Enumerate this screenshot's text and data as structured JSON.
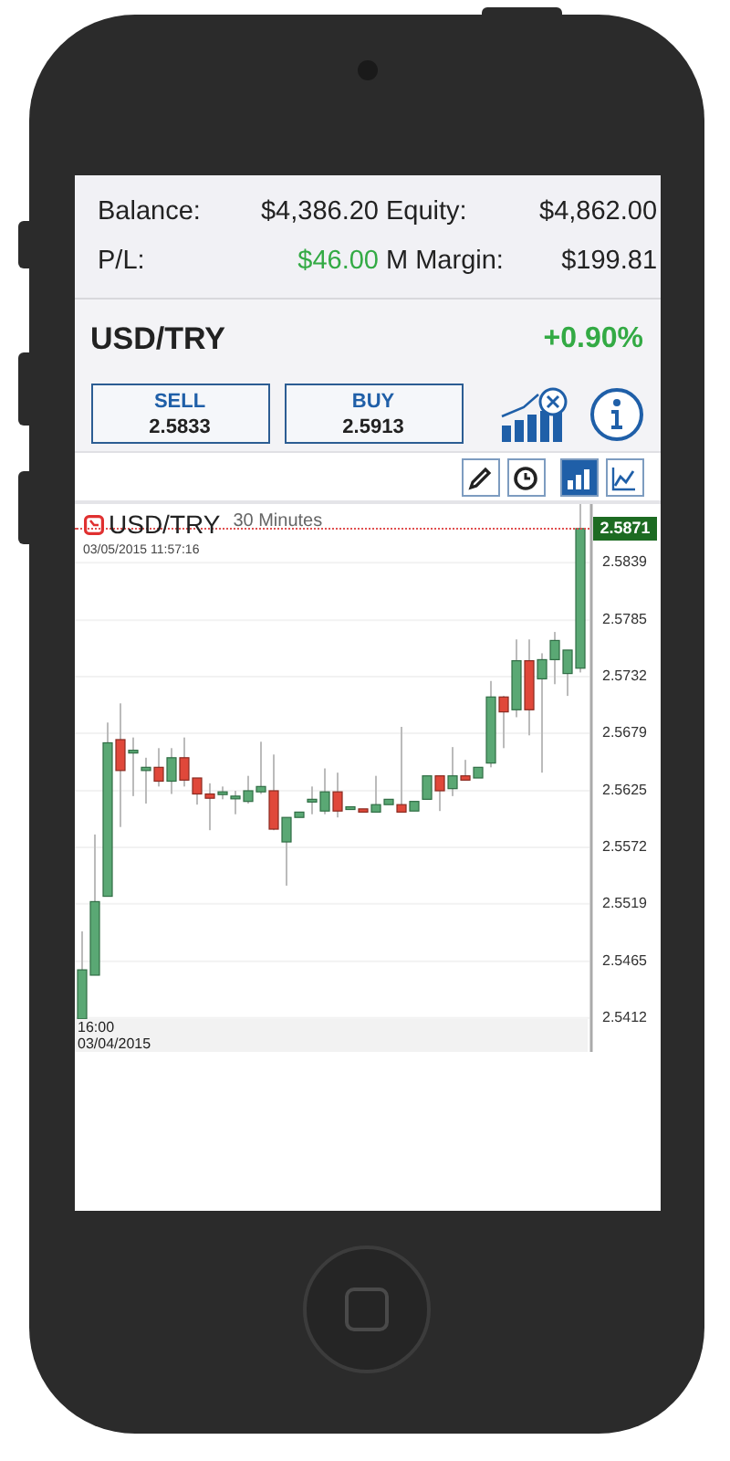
{
  "account": [
    {
      "label": "Balance:",
      "value": "$4,386.20",
      "positive": false
    },
    {
      "label": "Equity:",
      "value": "$4,862.00",
      "positive": false
    },
    {
      "label": "P/L:",
      "value": "$46.00",
      "positive": true
    },
    {
      "label": "M Margin:",
      "value": "$199.81",
      "positive": false
    }
  ],
  "instrument": {
    "symbol": "USD/TRY",
    "change": "+0.90%",
    "positive": true
  },
  "trade_buttons": [
    {
      "label": "SELL",
      "price": "2.5833"
    },
    {
      "label": "BUY",
      "price": "2.5913"
    }
  ],
  "toolbar": [
    {
      "kind": "pencil",
      "selected": false
    },
    {
      "kind": "clock",
      "selected": false
    },
    {
      "kind": "bars",
      "selected": true
    },
    {
      "kind": "line",
      "selected": false
    }
  ],
  "chart": {
    "symbol": "USD/TRY",
    "interval": "30 Minutes",
    "timestamp": "03/05/2015 11:57:16",
    "current_price": "2.5871",
    "time_label": "16:00",
    "date_label": "03/04/2015",
    "chart_data": {
      "type": "candlestick",
      "ylim": [
        2.538,
        2.5894
      ],
      "grid": true,
      "categories": [
        null,
        null,
        null,
        null,
        null,
        null,
        null,
        null,
        null,
        null,
        null,
        null,
        null,
        null,
        null,
        null,
        null,
        null,
        null,
        null,
        null,
        null,
        null,
        null,
        null,
        null,
        null,
        null,
        null,
        null,
        null,
        null,
        null,
        null,
        null,
        null,
        null,
        null,
        null,
        null
      ],
      "yticks": [
        {
          "value": 2.5839,
          "label": "2.5839"
        },
        {
          "value": 2.5785,
          "label": "2.5785"
        },
        {
          "value": 2.5732,
          "label": "2.5732"
        },
        {
          "value": 2.5679,
          "label": "2.5679"
        },
        {
          "value": 2.5625,
          "label": "2.5625"
        },
        {
          "value": 2.5572,
          "label": "2.5572"
        },
        {
          "value": 2.5519,
          "label": "2.5519"
        },
        {
          "value": 2.5465,
          "label": "2.5465"
        },
        {
          "value": 2.5412,
          "label": "2.5412"
        }
      ],
      "ohlc": [
        [
          2.5411,
          2.5493,
          2.5411,
          2.5457
        ],
        [
          2.5452,
          2.5584,
          2.5452,
          2.5521
        ],
        [
          2.5526,
          2.5689,
          2.5526,
          2.567
        ],
        [
          2.5673,
          2.5707,
          2.5591,
          2.5644
        ],
        [
          2.5661,
          2.5675,
          2.562,
          2.5663
        ],
        [
          2.5644,
          2.5656,
          2.5613,
          2.5647
        ],
        [
          2.5647,
          2.5665,
          2.5629,
          2.5634
        ],
        [
          2.5634,
          2.5665,
          2.5622,
          2.5656
        ],
        [
          2.5656,
          2.5675,
          2.5629,
          2.5635
        ],
        [
          2.5637,
          2.5637,
          2.5612,
          2.5622
        ],
        [
          2.5622,
          2.5632,
          2.5588,
          2.5618
        ],
        [
          2.5622,
          2.5629,
          2.5617,
          2.5624
        ],
        [
          2.5618,
          2.5625,
          2.5603,
          2.562
        ],
        [
          2.5615,
          2.5639,
          2.5613,
          2.5625
        ],
        [
          2.5624,
          2.5671,
          2.5622,
          2.5629
        ],
        [
          2.5625,
          2.5659,
          2.5588,
          2.5589
        ],
        [
          2.5577,
          2.56,
          2.5536,
          2.56
        ],
        [
          2.56,
          2.5605,
          2.56,
          2.5605
        ],
        [
          2.5615,
          2.5629,
          2.5603,
          2.5617
        ],
        [
          2.5606,
          2.5646,
          2.5603,
          2.5624
        ],
        [
          2.5624,
          2.5642,
          2.56,
          2.5606
        ],
        [
          2.5608,
          2.561,
          2.5608,
          2.561
        ],
        [
          2.5608,
          2.5608,
          2.5605,
          2.5605
        ],
        [
          2.5605,
          2.5639,
          2.5605,
          2.5612
        ],
        [
          2.5612,
          2.5617,
          2.5612,
          2.5617
        ],
        [
          2.5612,
          2.5685,
          2.5605,
          2.5605
        ],
        [
          2.5606,
          2.5615,
          2.5606,
          2.5615
        ],
        [
          2.5617,
          2.5639,
          2.5617,
          2.5639
        ],
        [
          2.5639,
          2.5639,
          2.5606,
          2.5625
        ],
        [
          2.5627,
          2.5666,
          2.562,
          2.5639
        ],
        [
          2.5639,
          2.5654,
          2.5635,
          2.5635
        ],
        [
          2.5637,
          2.5647,
          2.5637,
          2.5647
        ],
        [
          2.5651,
          2.5728,
          2.5647,
          2.5713
        ],
        [
          2.5713,
          2.5714,
          2.5665,
          2.5699
        ],
        [
          2.5701,
          2.5767,
          2.5694,
          2.5747
        ],
        [
          2.5747,
          2.5767,
          2.5677,
          2.5701
        ],
        [
          2.573,
          2.5754,
          2.5642,
          2.5748
        ],
        [
          2.5748,
          2.5774,
          2.5725,
          2.5766
        ],
        [
          2.5735,
          2.5757,
          2.5714,
          2.5757
        ],
        [
          2.574,
          2.5894,
          2.5736,
          2.5871
        ]
      ]
    }
  }
}
